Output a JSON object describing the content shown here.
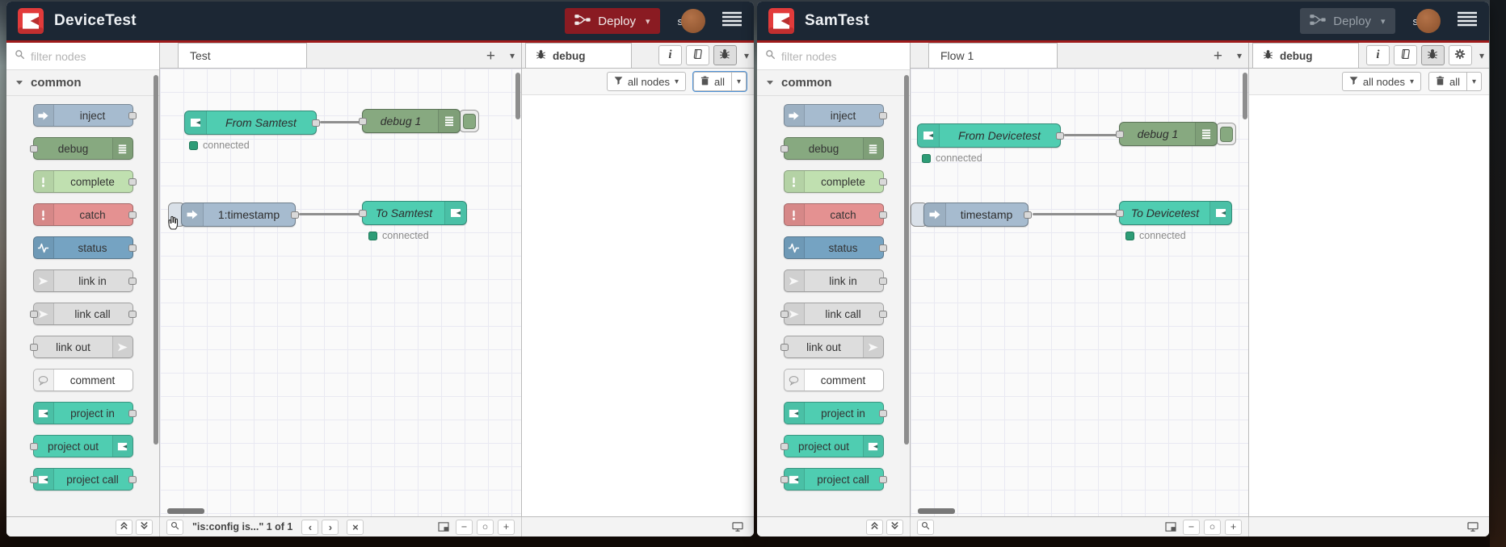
{
  "colors": {
    "header_bg": "#1c2734",
    "accent_red_line": "#9e1b1b",
    "deploy_red": "#8a1b22",
    "deploy_disabled": "#3d4651",
    "status_green": "#2d9c76",
    "node_inject": "#a6bbcf",
    "node_debug": "#87a980",
    "node_complete": "#c0e0b0",
    "node_catch": "#e49191",
    "node_status": "#75a3c2",
    "node_link": "#dddddd",
    "node_comment": "#ffffff",
    "node_project": "#4fcdb1"
  },
  "glyphs": {
    "caret": "▾",
    "plus": "+",
    "minus": "−",
    "zoom_reset": "○",
    "close": "×",
    "info": "i",
    "prev": "‹",
    "next": "›"
  },
  "shared": {
    "palette": {
      "search_placeholder": "filter nodes",
      "category_label": "common",
      "items": [
        {
          "label": "inject",
          "color": "#a6bbcf",
          "icon": "inject-icon",
          "icon_side": "left",
          "port_left": false,
          "port_right": true
        },
        {
          "label": "debug",
          "color": "#87a980",
          "icon": "debug-icon",
          "icon_side": "right",
          "port_left": true,
          "port_right": false
        },
        {
          "label": "complete",
          "color": "#c0e0b0",
          "icon": "exclamation-icon",
          "icon_side": "left",
          "port_left": false,
          "port_right": true
        },
        {
          "label": "catch",
          "color": "#e49191",
          "icon": "exclamation-icon",
          "icon_side": "left",
          "port_left": false,
          "port_right": true
        },
        {
          "label": "status",
          "color": "#75a3c2",
          "icon": "status-icon",
          "icon_side": "left",
          "port_left": false,
          "port_right": true
        },
        {
          "label": "link in",
          "color": "#dddddd",
          "icon": "link-icon",
          "icon_side": "left",
          "port_left": false,
          "port_right": true
        },
        {
          "label": "link call",
          "color": "#dddddd",
          "icon": "link-icon",
          "icon_side": "left",
          "port_left": true,
          "port_right": true
        },
        {
          "label": "link out",
          "color": "#dddddd",
          "icon": "link-icon",
          "icon_side": "right",
          "port_left": true,
          "port_right": false
        },
        {
          "label": "comment",
          "color": "#ffffff",
          "icon": "comment-icon",
          "icon_side": "left",
          "port_left": false,
          "port_right": false
        },
        {
          "label": "project in",
          "color": "#4fcdb1",
          "icon": "project-icon",
          "icon_side": "left",
          "port_left": false,
          "port_right": true
        },
        {
          "label": "project out",
          "color": "#4fcdb1",
          "icon": "project-icon",
          "icon_side": "right",
          "port_left": true,
          "port_right": false
        },
        {
          "label": "project call",
          "color": "#4fcdb1",
          "icon": "project-icon",
          "icon_side": "left",
          "port_left": true,
          "port_right": true
        }
      ]
    },
    "debug_filter_nodes_label": "all nodes",
    "debug_filter_trash_label": "all",
    "status_connected_label": "connected"
  },
  "windows": [
    {
      "title": "DeviceTest",
      "deploy_label": "Deploy",
      "deploy_enabled": true,
      "username": "s",
      "workspace_tab": "Test",
      "debug_tab": "debug",
      "has_gear_button": false,
      "trash_filter_focused": true,
      "cursor_over_inject_button": true,
      "footer_search_result": "\"is:config is...\" 1 of 1",
      "footer_has_search_nav": true,
      "flows": [
        {
          "source": {
            "label": "From Samtest",
            "type": "project in",
            "color": "#4fcdb1",
            "modified": true,
            "status": "connected"
          },
          "target": {
            "label": "debug 1",
            "type": "debug",
            "color": "#87a980",
            "modified": true,
            "enabled": true
          }
        },
        {
          "source": {
            "label": "1:timestamp",
            "type": "inject",
            "color": "#a6bbcf",
            "modified": false
          },
          "target": {
            "label": "To Samtest",
            "type": "project out",
            "color": "#4fcdb1",
            "modified": true,
            "status": "connected"
          }
        }
      ]
    },
    {
      "title": "SamTest",
      "deploy_label": "Deploy",
      "deploy_enabled": false,
      "username": "s",
      "workspace_tab": "Flow 1",
      "debug_tab": "debug",
      "has_gear_button": true,
      "trash_filter_focused": false,
      "cursor_over_inject_button": false,
      "footer_search_result": "",
      "footer_has_search_nav": false,
      "flows": [
        {
          "source": {
            "label": "From Devicetest",
            "type": "project in",
            "color": "#4fcdb1",
            "modified": true,
            "status": "connected"
          },
          "target": {
            "label": "debug 1",
            "type": "debug",
            "color": "#87a980",
            "modified": true,
            "enabled": true
          }
        },
        {
          "source": {
            "label": "timestamp",
            "type": "inject",
            "color": "#a6bbcf",
            "modified": false
          },
          "target": {
            "label": "To Devicetest",
            "type": "project out",
            "color": "#4fcdb1",
            "modified": true,
            "status": "connected"
          }
        }
      ]
    }
  ]
}
